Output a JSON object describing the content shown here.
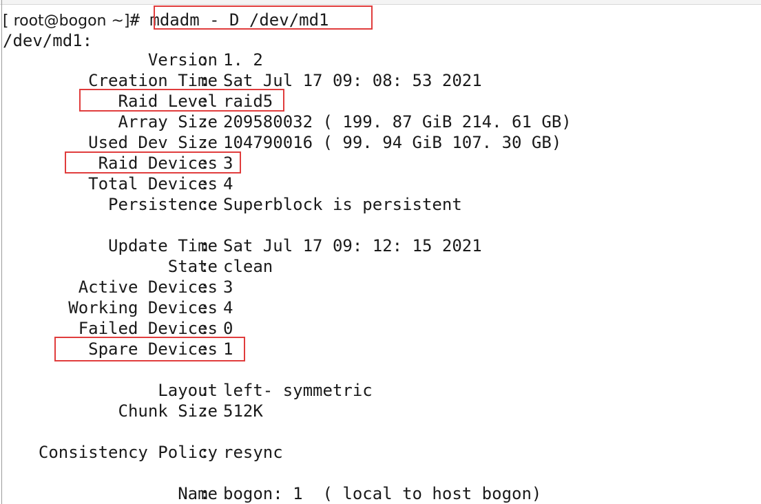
{
  "terminal": {
    "prompt": "[ root@bogon ~]",
    "prompt_char": "#",
    "command": " mdadm - D /dev/md1",
    "device_header": "/dev/md1:",
    "fields": [
      {
        "key": "Version",
        "value": "1. 2"
      },
      {
        "key": "Creation Time",
        "value": "Sat Jul 17 09: 08: 53 2021"
      },
      {
        "key": "Raid Level",
        "value": "raid5"
      },
      {
        "key": "Array Size",
        "value": "209580032 ( 199. 87 GiB 214. 61 GB)"
      },
      {
        "key": "Used Dev Size",
        "value": "104790016 ( 99. 94 GiB 107. 30 GB)"
      },
      {
        "key": "Raid Devices",
        "value": "3"
      },
      {
        "key": "Total Devices",
        "value": "4"
      },
      {
        "key": "Persistence",
        "value": "Superblock is persistent"
      },
      {
        "key": "Update Time",
        "value": "Sat Jul 17 09: 12: 15 2021"
      },
      {
        "key": "State",
        "value": "clean"
      },
      {
        "key": "Active Devices",
        "value": "3"
      },
      {
        "key": "Working Devices",
        "value": "4"
      },
      {
        "key": "Failed Devices",
        "value": "0"
      },
      {
        "key": "Spare Devices",
        "value": "1"
      },
      {
        "key": "Layout",
        "value": "left- symmetric"
      },
      {
        "key": "Chunk Size",
        "value": "512K"
      },
      {
        "key": "Consistency Policy",
        "value": "resync"
      },
      {
        "key": "Name",
        "value": "bogon: 1  ( local to host bogon)"
      }
    ],
    "separator": ":",
    "highlight_color": "#e03c3c"
  }
}
